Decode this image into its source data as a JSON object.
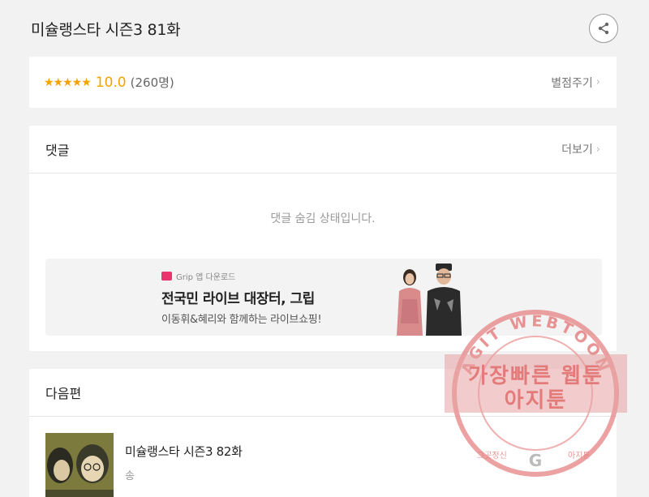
{
  "header": {
    "title": "미슐랭스타 시즌3 81화",
    "share_icon": "share-icon"
  },
  "rating": {
    "stars": "★★★★★",
    "score": "10.0",
    "count": "(260명)",
    "rate_link": "별점주기"
  },
  "comments": {
    "label": "댓글",
    "more_link": "더보기",
    "hidden_message": "댓글 숨김 상태입니다."
  },
  "ad": {
    "small_label": "Grip 앱 다운로드",
    "title": "전국민 라이브 대장터, 그립",
    "description": "이동휘&혜리와 함께하는 라이브쇼핑!",
    "logo_color": "#e8336e"
  },
  "next": {
    "label": "다음편",
    "episode_title": "미슐랭스타 시즌3 82화",
    "author": "송"
  },
  "watermark": {
    "arc_text": "AGIT WEBTOON",
    "line1": "가장빠른 웹툰",
    "line2": "아지툰",
    "bottom_left": "그곳정신",
    "bottom_right": "아지툰",
    "color": "#e47b7b"
  },
  "colors": {
    "accent_star": "#f4a300",
    "background": "#f2f2f2"
  }
}
